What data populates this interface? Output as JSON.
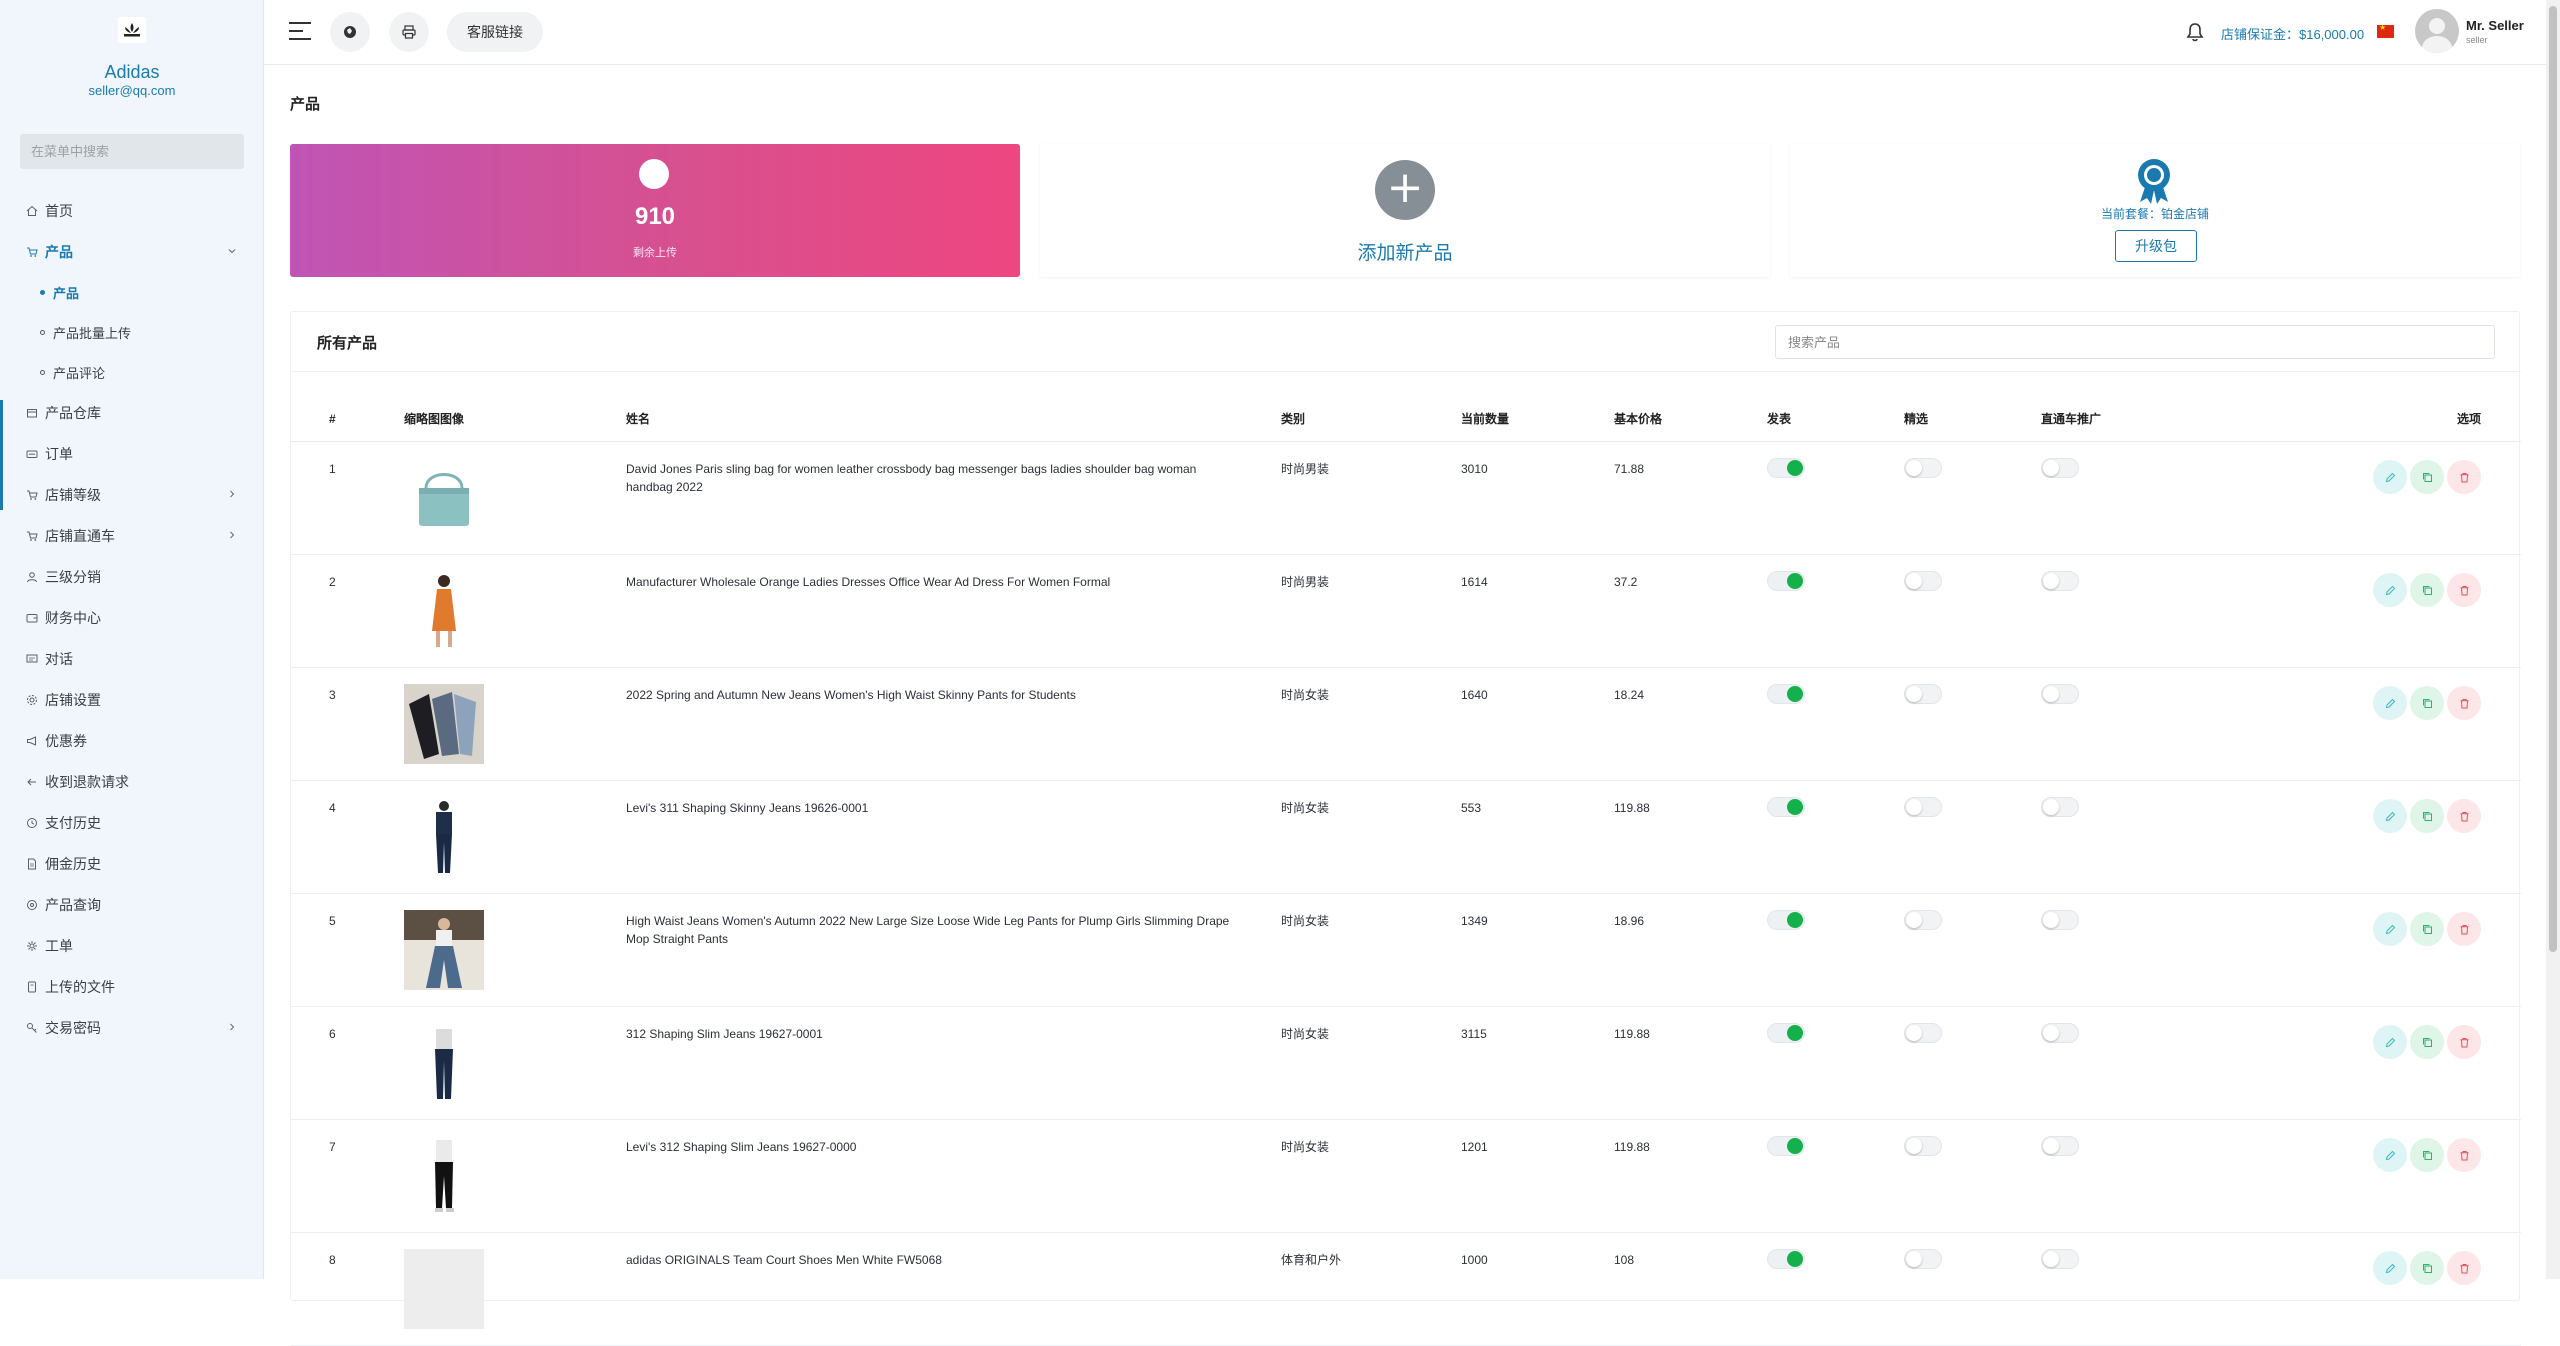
{
  "sidebar": {
    "brand_name": "Adidas",
    "brand_email": "seller@qq.com",
    "search_placeholder": "在菜单中搜索",
    "items": [
      {
        "label": "首页",
        "icon": "home-icon"
      },
      {
        "label": "产品",
        "icon": "cart-icon",
        "active": true,
        "expanded": true,
        "children": [
          {
            "label": "产品",
            "active": true
          },
          {
            "label": "产品批量上传"
          },
          {
            "label": "产品评论"
          }
        ]
      },
      {
        "label": "产品仓库",
        "icon": "warehouse-icon"
      },
      {
        "label": "订单",
        "icon": "order-icon"
      },
      {
        "label": "店铺等级",
        "icon": "cart-icon",
        "has_children": true
      },
      {
        "label": "店铺直通车",
        "icon": "cart-icon",
        "has_children": true
      },
      {
        "label": "三级分销",
        "icon": "user-icon"
      },
      {
        "label": "财务中心",
        "icon": "wallet-icon"
      },
      {
        "label": "对话",
        "icon": "chat-icon"
      },
      {
        "label": "店铺设置",
        "icon": "gear-icon"
      },
      {
        "label": "优惠券",
        "icon": "megaphone-icon"
      },
      {
        "label": "收到退款请求",
        "icon": "refund-icon"
      },
      {
        "label": "支付历史",
        "icon": "history-icon"
      },
      {
        "label": "佣金历史",
        "icon": "document-icon"
      },
      {
        "label": "产品查询",
        "icon": "help-icon"
      },
      {
        "label": "工单",
        "icon": "settings-icon"
      },
      {
        "label": "上传的文件",
        "icon": "file-icon"
      },
      {
        "label": "交易密码",
        "icon": "key-icon",
        "has_children": true
      }
    ]
  },
  "topbar": {
    "customer_link_label": "客服链接",
    "deposit_text": "店铺保证金：$16,000.00",
    "user_name": "Mr. Seller",
    "user_role": "seller"
  },
  "page": {
    "title": "产品"
  },
  "cards": {
    "remaining_count": "910",
    "remaining_label": "剩余上传",
    "add_product_label": "添加新产品",
    "package_label": "当前套餐：铂金店铺",
    "upgrade_label": "升级包"
  },
  "products": {
    "title": "所有产品",
    "search_placeholder": "搜索产品",
    "columns": [
      "#",
      "缩略图图像",
      "姓名",
      "类别",
      "当前数量",
      "基本价格",
      "发表",
      "精选",
      "直通车推广",
      "选项"
    ],
    "rows": [
      {
        "num": "1",
        "name": "David Jones Paris sling bag for women leather crossbody bag messenger bags ladies shoulder bag woman handbag 2022",
        "category": "时尚男装",
        "qty": "3010",
        "price": "71.88",
        "published": true,
        "featured": false,
        "promoted": false
      },
      {
        "num": "2",
        "name": "Manufacturer Wholesale Orange Ladies Dresses Office Wear Ad Dress For Women Formal",
        "category": "时尚男装",
        "qty": "1614",
        "price": "37.2",
        "published": true,
        "featured": false,
        "promoted": false
      },
      {
        "num": "3",
        "name": "2022 Spring and Autumn New Jeans Women's High Waist Skinny Pants for Students",
        "category": "时尚女装",
        "qty": "1640",
        "price": "18.24",
        "published": true,
        "featured": false,
        "promoted": false
      },
      {
        "num": "4",
        "name": "Levi's 311 Shaping Skinny Jeans 19626-0001",
        "category": "时尚女装",
        "qty": "553",
        "price": "119.88",
        "published": true,
        "featured": false,
        "promoted": false
      },
      {
        "num": "5",
        "name": "High Waist Jeans Women's Autumn 2022 New Large Size Loose Wide Leg Pants for Plump Girls Slimming Drape Mop Straight Pants",
        "category": "时尚女装",
        "qty": "1349",
        "price": "18.96",
        "published": true,
        "featured": false,
        "promoted": false
      },
      {
        "num": "6",
        "name": "312 Shaping Slim Jeans 19627-0001",
        "category": "时尚女装",
        "qty": "3115",
        "price": "119.88",
        "published": true,
        "featured": false,
        "promoted": false
      },
      {
        "num": "7",
        "name": "Levi's 312 Shaping Slim Jeans 19627-0000",
        "category": "时尚女装",
        "qty": "1201",
        "price": "119.88",
        "published": true,
        "featured": false,
        "promoted": false
      },
      {
        "num": "8",
        "name": "adidas ORIGINALS Team Court Shoes Men White FW5068",
        "category": "体育和户外",
        "qty": "1000",
        "price": "108",
        "published": true,
        "featured": false,
        "promoted": false
      }
    ]
  },
  "colors": {
    "accent": "#1a7ab0",
    "toggle_on": "#13b04b",
    "card_gradient_start": "#c054b5",
    "card_gradient_end": "#ee4680"
  }
}
